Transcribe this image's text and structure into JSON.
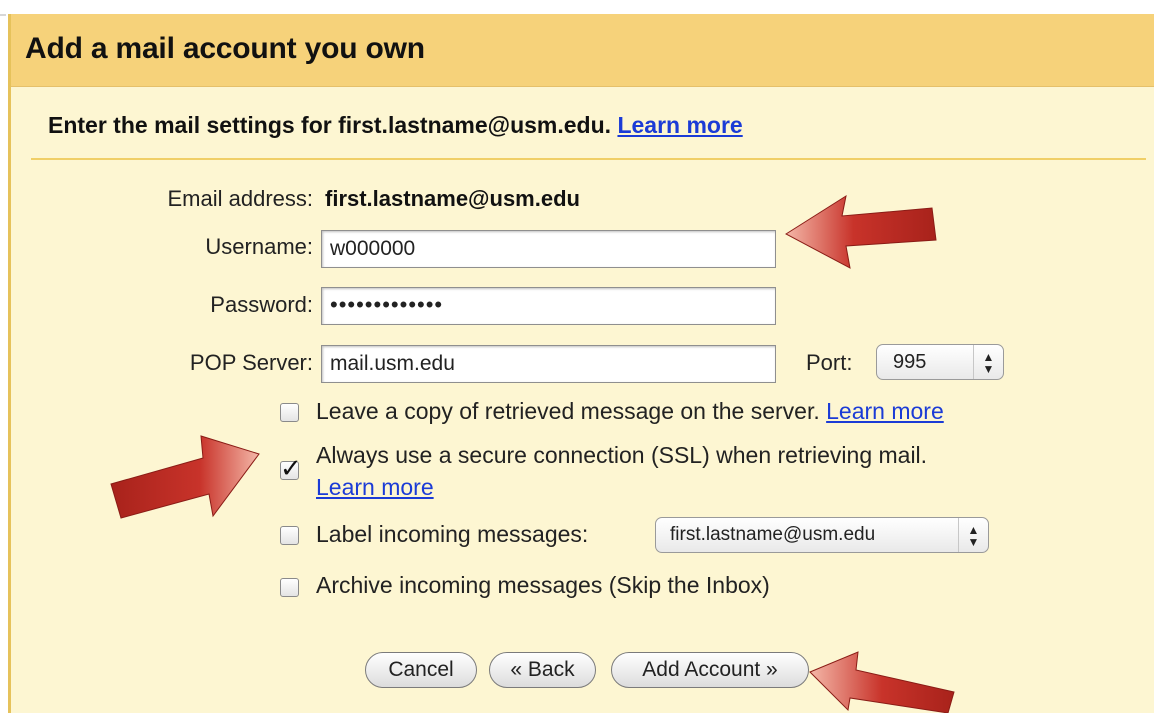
{
  "dialog": {
    "title": "Add a mail account you own",
    "subheading": "Enter the mail settings for first.lastname@usm.edu.",
    "subheading_link": "Learn more"
  },
  "form": {
    "email_label": "Email address:",
    "email_value": "first.lastname@usm.edu",
    "username_label": "Username:",
    "username_value": "w000000",
    "password_label": "Password:",
    "password_mask": "•••••••••••••",
    "pop_label": "POP Server:",
    "pop_value": "mail.usm.edu",
    "port_label": "Port:",
    "port_value": "995"
  },
  "options": [
    {
      "label": "Leave a copy of retrieved message on the server.",
      "link": "Learn more",
      "checked": false
    },
    {
      "label": "Always use a secure connection (SSL) when retrieving mail.",
      "link": "Learn more",
      "checked": true
    },
    {
      "label": "Label incoming messages:",
      "select_value": "first.lastname@usm.edu",
      "checked": false
    },
    {
      "label": "Archive incoming messages (Skip the Inbox)",
      "checked": false
    }
  ],
  "buttons": {
    "cancel": "Cancel",
    "back": "« Back",
    "add_account": "Add Account »"
  },
  "colors": {
    "header_bg": "#f6d27a",
    "panel_bg": "#fdf6d2",
    "link": "#1b3bd6",
    "annotation_arrow": "#b3261e"
  }
}
